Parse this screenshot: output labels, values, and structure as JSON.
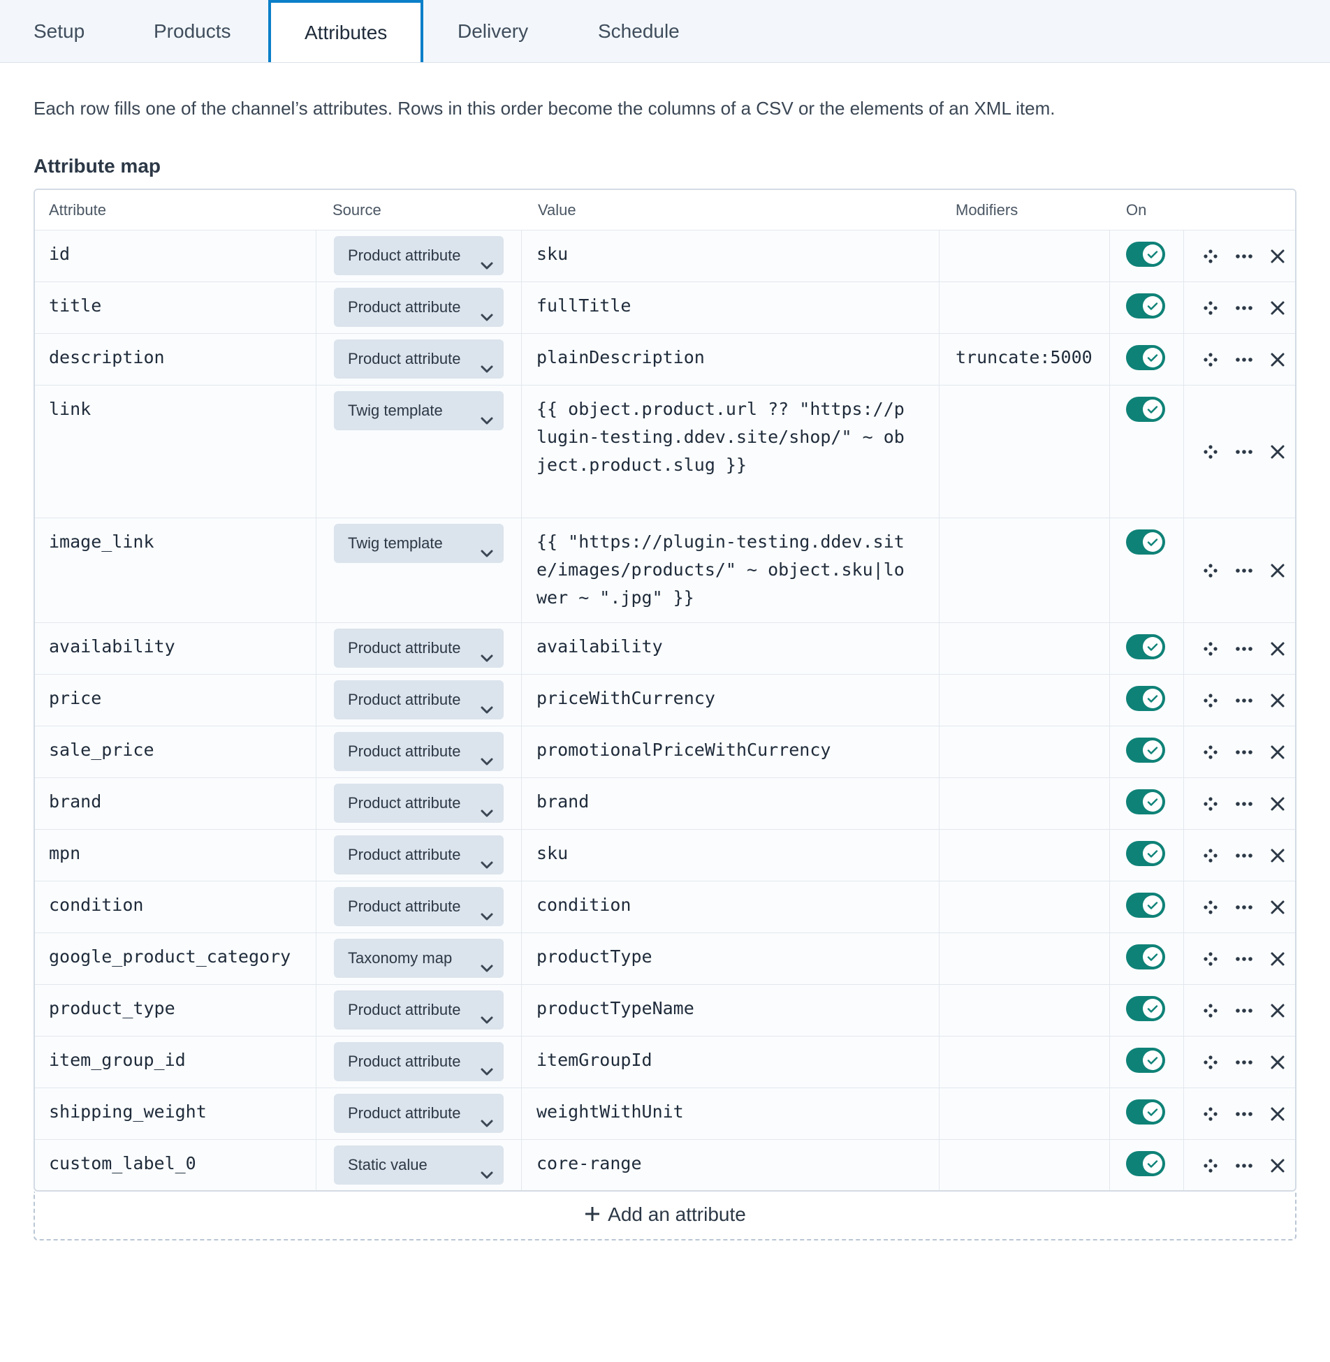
{
  "tabs": [
    {
      "label": "Setup",
      "active": false
    },
    {
      "label": "Products",
      "active": false
    },
    {
      "label": "Attributes",
      "active": true
    },
    {
      "label": "Delivery",
      "active": false
    },
    {
      "label": "Schedule",
      "active": false
    }
  ],
  "intro": "Each row fills one of the channel’s attributes. Rows in this order become the columns of a CSV or the elements of an XML item.",
  "section_title": "Attribute map",
  "columns": {
    "attribute": "Attribute",
    "source": "Source",
    "value": "Value",
    "modifiers": "Modifiers",
    "on": "On"
  },
  "rows": [
    {
      "attribute": "id",
      "source": "Product attribute",
      "value": "sku",
      "modifiers": "",
      "on": true
    },
    {
      "attribute": "title",
      "source": "Product attribute",
      "value": "fullTitle",
      "modifiers": "",
      "on": true
    },
    {
      "attribute": "description",
      "source": "Product attribute",
      "value": "plainDescription",
      "modifiers": "truncate:5000",
      "on": true
    },
    {
      "attribute": "link",
      "source": "Twig template",
      "value": "{{ object.product.url ?? \"https://plugin-testing.ddev.site/shop/\" ~ object.product.slug }}",
      "modifiers": "",
      "on": true
    },
    {
      "attribute": "image_link",
      "source": "Twig template",
      "value": "{{ \"https://plugin-testing.ddev.site/images/products/\" ~ object.sku|lower ~ \".jpg\" }}",
      "modifiers": "",
      "on": true
    },
    {
      "attribute": "availability",
      "source": "Product attribute",
      "value": "availability",
      "modifiers": "",
      "on": true
    },
    {
      "attribute": "price",
      "source": "Product attribute",
      "value": "priceWithCurrency",
      "modifiers": "",
      "on": true
    },
    {
      "attribute": "sale_price",
      "source": "Product attribute",
      "value": "promotionalPriceWithCurrency",
      "modifiers": "",
      "on": true
    },
    {
      "attribute": "brand",
      "source": "Product attribute",
      "value": "brand",
      "modifiers": "",
      "on": true
    },
    {
      "attribute": "mpn",
      "source": "Product attribute",
      "value": "sku",
      "modifiers": "",
      "on": true
    },
    {
      "attribute": "condition",
      "source": "Product attribute",
      "value": "condition",
      "modifiers": "",
      "on": true
    },
    {
      "attribute": "google_product_category",
      "source": "Taxonomy map",
      "value": "productType",
      "modifiers": "",
      "on": true
    },
    {
      "attribute": "product_type",
      "source": "Product attribute",
      "value": "productTypeName",
      "modifiers": "",
      "on": true
    },
    {
      "attribute": "item_group_id",
      "source": "Product attribute",
      "value": "itemGroupId",
      "modifiers": "",
      "on": true
    },
    {
      "attribute": "shipping_weight",
      "source": "Product attribute",
      "value": "weightWithUnit",
      "modifiers": "",
      "on": true
    },
    {
      "attribute": "custom_label_0",
      "source": "Static value",
      "value": "core-range",
      "modifiers": "",
      "on": true
    }
  ],
  "add_label": "Add an attribute",
  "colors": {
    "accent": "#0b7fc8",
    "toggle_on": "#0f8277"
  },
  "icons": {
    "row_actions": [
      "drag-handle-icon",
      "more-icon",
      "close-icon"
    ],
    "select": "chevron-down-icon",
    "toggle": "check-icon",
    "add": "plus-icon"
  }
}
